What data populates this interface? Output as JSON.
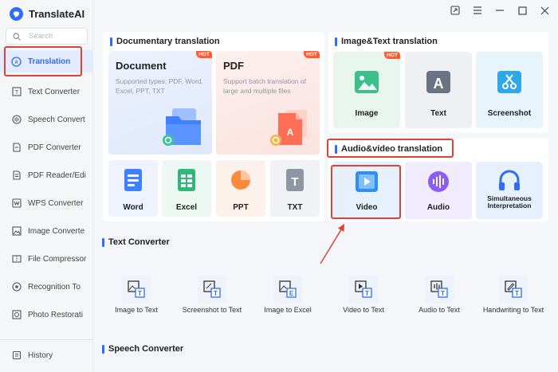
{
  "app": {
    "title": "TranslateAI"
  },
  "sidebar": {
    "search_placeholder": "Search",
    "items": [
      {
        "label": "Translation",
        "icon": "translate-icon"
      },
      {
        "label": "Text Converter",
        "icon": "text-converter-icon"
      },
      {
        "label": "Speech Convert",
        "icon": "speech-icon"
      },
      {
        "label": "PDF Converter",
        "icon": "pdf-icon"
      },
      {
        "label": "PDF Reader/Edi",
        "icon": "pdf-reader-icon"
      },
      {
        "label": "WPS Converter",
        "icon": "wps-icon"
      },
      {
        "label": "Image Converte",
        "icon": "image-icon"
      },
      {
        "label": "File Compressor",
        "icon": "compress-icon"
      },
      {
        "label": "Recognition To",
        "icon": "recognition-icon"
      },
      {
        "label": "Photo Restorati",
        "icon": "photo-icon"
      }
    ],
    "history": "History"
  },
  "documentary": {
    "title": "Documentary translation",
    "document": {
      "title": "Document",
      "desc": "Supported types: PDF, Word, Excel, PPT, TXT",
      "badge": "HOT"
    },
    "pdf": {
      "title": "PDF",
      "desc": "Support batch translation of large and multiple files",
      "badge": "HOT"
    },
    "formats": [
      "Word",
      "Excel",
      "PPT",
      "TXT"
    ]
  },
  "image_text": {
    "title": "Image&Text translation",
    "cards": [
      "Image",
      "Text",
      "Screenshot"
    ],
    "badge": "HOT"
  },
  "audio_video": {
    "title": "Audio&video translation",
    "cards": [
      "Video",
      "Audio",
      "Simultaneous Interpretation"
    ]
  },
  "text_converter": {
    "title": "Text Converter",
    "items": [
      "Image to Text",
      "Screenshot to Text",
      "Image to Excel",
      "Video to Text",
      "Audio to Text",
      "Handwriting to Text"
    ]
  },
  "speech_converter": {
    "title": "Speech Converter"
  },
  "colors": {
    "accent": "#2f6df6",
    "highlight": "#e04336",
    "hot": "#ff5b2e"
  }
}
